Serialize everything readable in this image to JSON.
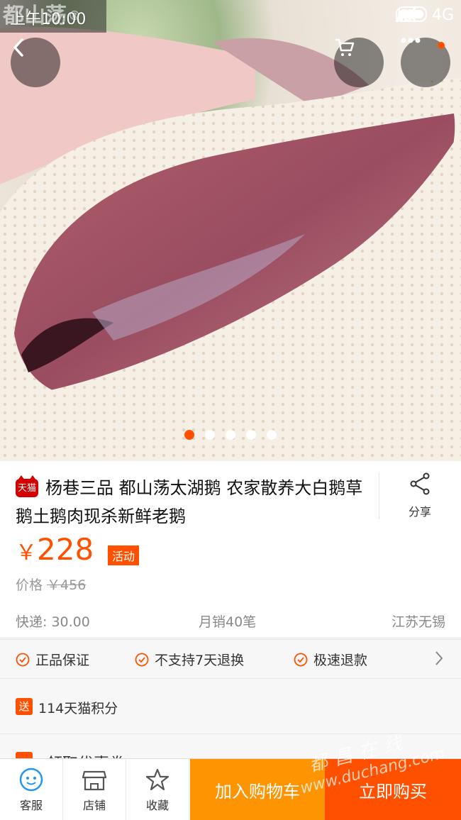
{
  "status_bar": {
    "time": "上午10:00",
    "network": "4G"
  },
  "watermark_top": {
    "text": "都山荡",
    "mark": "®"
  },
  "carousel": {
    "total": 5,
    "active": 0
  },
  "product": {
    "tmall_badge": "天猫",
    "title": "杨巷三品 都山荡太湖鹅 农家散养大白鹅草鹅土鹅肉现杀新鲜老鹅",
    "share_label": "分享",
    "currency": "￥",
    "price": "228",
    "promo_tag": "活动",
    "original_price_label": "价格",
    "original_price": "￥456",
    "shipping": "快递: 30.00",
    "monthly_sales": "月销40笔",
    "location": "江苏无锡"
  },
  "guarantees": [
    "正品保证",
    "不支持7天退换",
    "极速退款"
  ],
  "points": {
    "badge": "送",
    "text": "114天猫积分"
  },
  "coupon": {
    "text": "领取优惠券"
  },
  "bottom_bar": {
    "service": "客服",
    "shop": "店铺",
    "favorite": "收藏",
    "add_to_cart": "加入购物车",
    "buy_now": "立即购买"
  },
  "watermark_bottom": {
    "cn": "都昌在线",
    "url": "www.duchang.com"
  },
  "colors": {
    "accent": "#ff5000",
    "cart_orange": "#ff9402",
    "tmall_red": "#d40000"
  }
}
